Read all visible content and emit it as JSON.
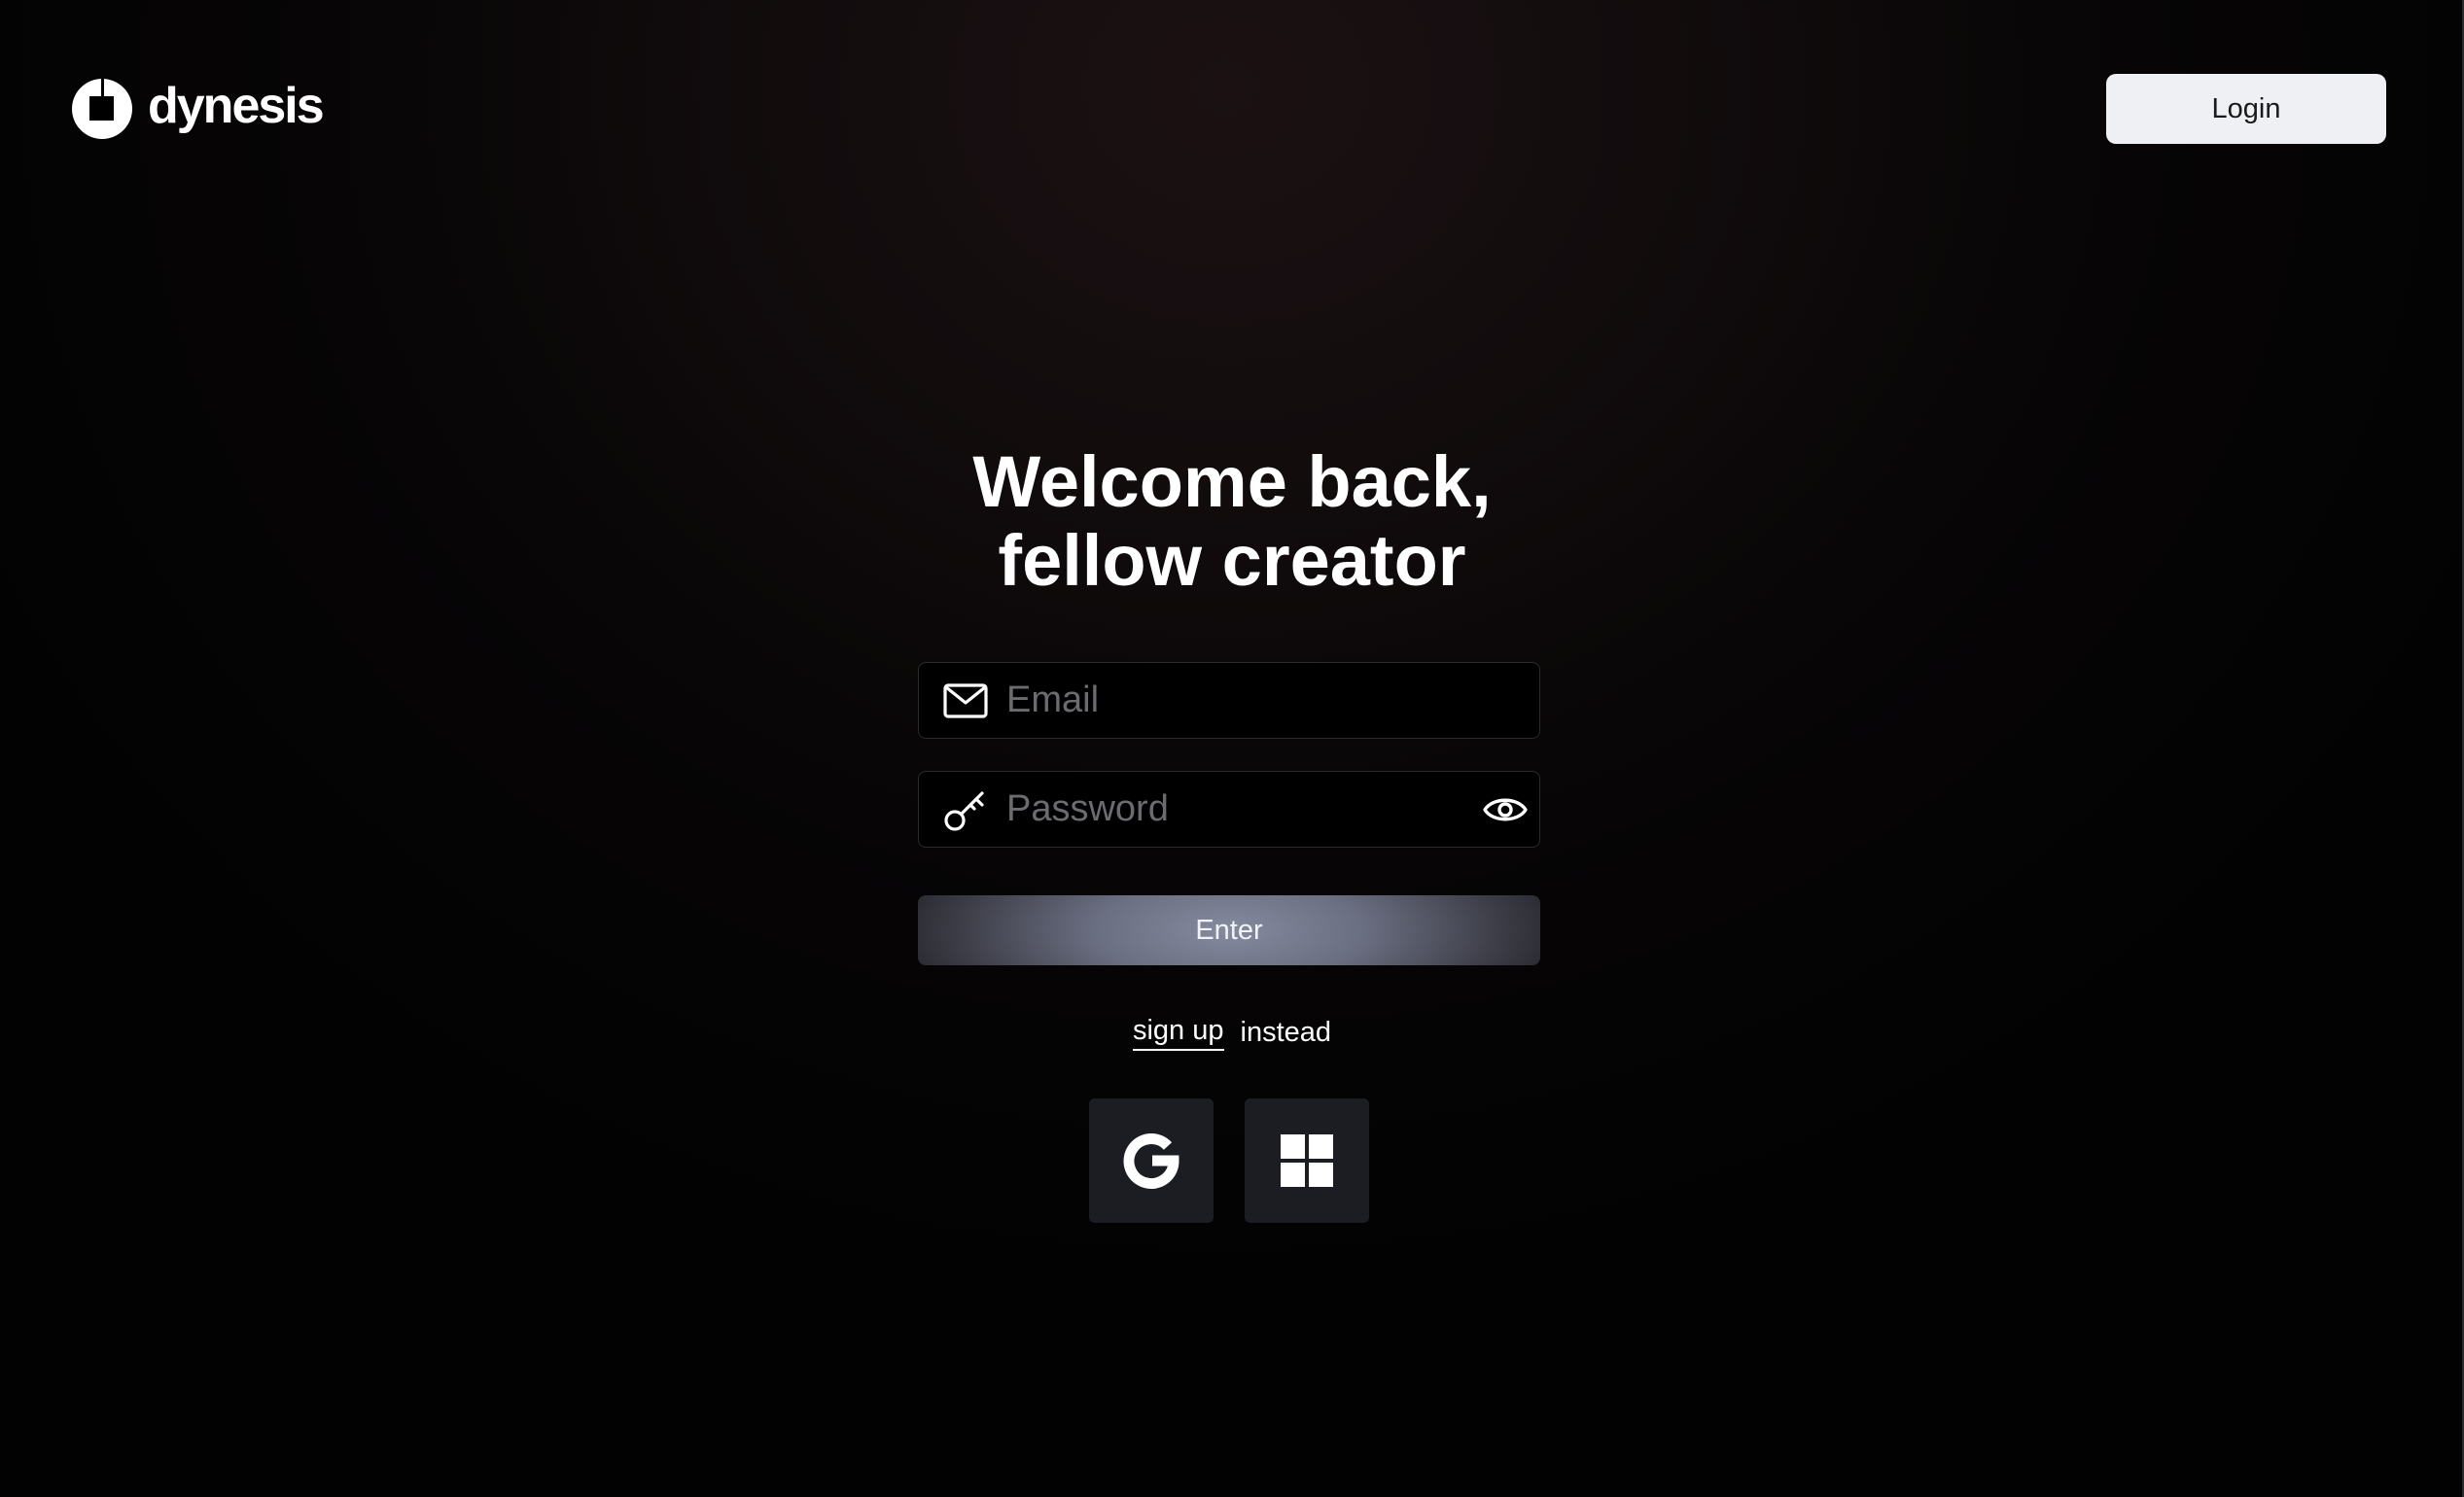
{
  "header": {
    "logo_text": "dynesis",
    "logo_icon": "dynesis-logo-icon",
    "login_label": "Login"
  },
  "main": {
    "title_line1": "Welcome back,",
    "title_line2": "fellow creator",
    "email": {
      "placeholder": "Email",
      "value": "",
      "icon": "mail-icon"
    },
    "password": {
      "placeholder": "Password",
      "value": "",
      "icon": "key-icon",
      "toggle_icon": "eye-icon"
    },
    "enter_label": "Enter",
    "signup_link": "sign up",
    "signup_suffix": "instead",
    "social": [
      {
        "name": "google",
        "icon": "google-icon"
      },
      {
        "name": "microsoft",
        "icon": "microsoft-icon"
      }
    ]
  },
  "colors": {
    "background": "#0a0708",
    "field_background": "#000000",
    "field_border": "#2b2b2e",
    "login_button_bg": "#eef0f4",
    "enter_button_center": "#858a9e",
    "social_button_bg": "#1c1d22",
    "placeholder": "#6b6b70",
    "text": "#ffffff"
  }
}
